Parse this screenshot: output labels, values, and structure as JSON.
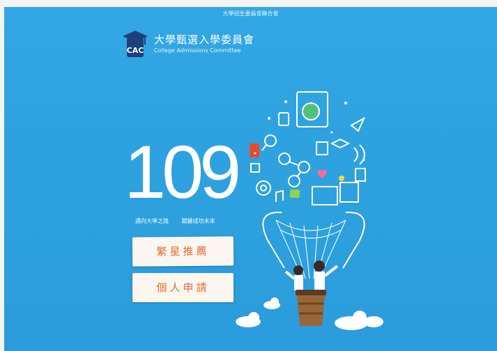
{
  "topbar": {
    "text": "大學招生委員會聯合會"
  },
  "header": {
    "logo_text": "CAC",
    "title": "大學甄選入學委員會",
    "subtitle": "College Admissions Committee"
  },
  "hero": {
    "year": "109",
    "slogan_left": "邁向大學之路",
    "slogan_right": "關鍵成功未來"
  },
  "buttons": {
    "star_plan": "繁星推薦",
    "personal_application": "個人申請"
  },
  "colors": {
    "background": "#2ea2e0",
    "button_bg": "#fbf6f0",
    "button_text": "#e46b34",
    "logo_navy": "#1d3f7a"
  }
}
